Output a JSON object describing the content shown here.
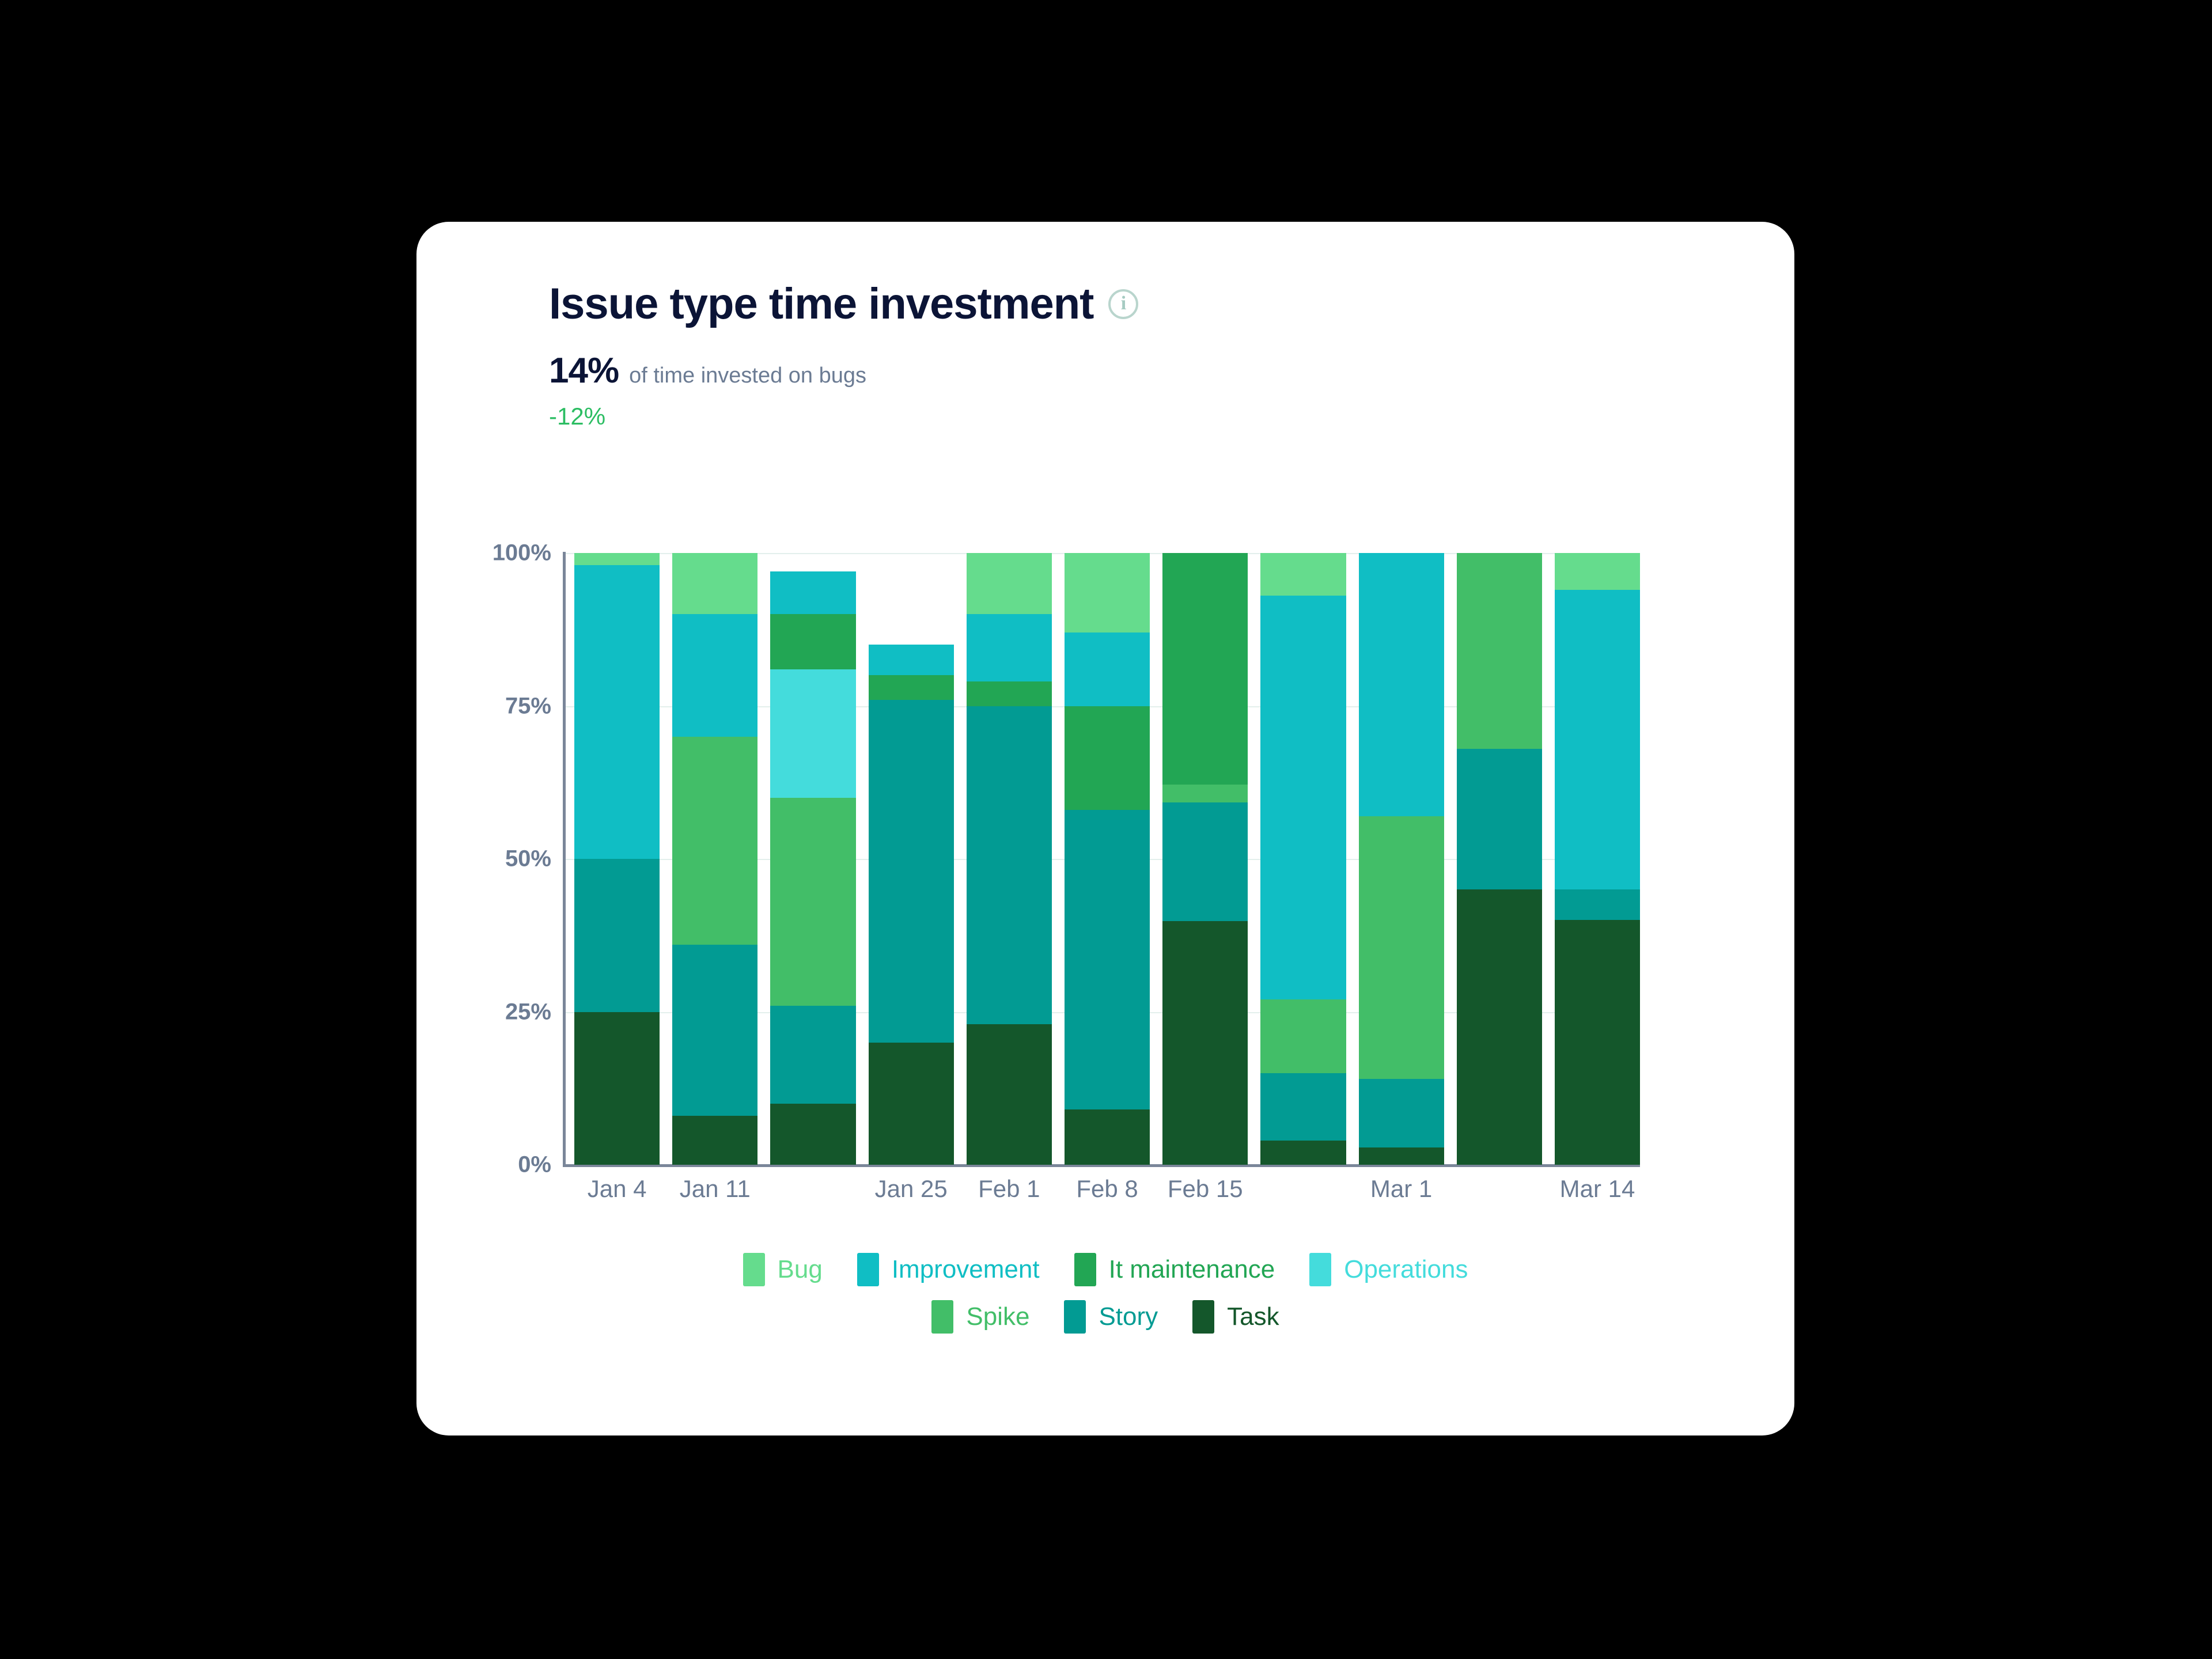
{
  "card": {
    "title": "Issue type time investment",
    "info_icon": "info-circle-icon",
    "kpi_value": "14%",
    "kpi_label": "of time invested on bugs",
    "kpi_delta": "-12%",
    "delta_color": "#2bbd62"
  },
  "chart_data": {
    "type": "bar",
    "stacked": true,
    "normalized_percent": true,
    "title": "Issue type time investment",
    "xlabel": "",
    "ylabel": "",
    "ylim": [
      0,
      100
    ],
    "yticks": [
      "0%",
      "25%",
      "50%",
      "75%",
      "100%"
    ],
    "ytick_values": [
      0,
      25,
      50,
      75,
      100
    ],
    "grid": true,
    "legend_position": "bottom",
    "categories": [
      "Jan 4",
      "Jan 11",
      "",
      "Jan 25",
      "Feb 1",
      "Feb 8",
      "Feb 15",
      "",
      "Mar 1",
      "",
      "Mar 14"
    ],
    "x_tick_labels_visible": [
      "Jan 4",
      "Jan 11",
      "Jan 25",
      "Feb 1",
      "Feb 8",
      "Feb 15",
      "Mar 1",
      "Mar 14"
    ],
    "series": [
      {
        "name": "Bug",
        "color": "#65DC8D",
        "values": [
          2,
          10,
          0,
          0,
          10,
          13,
          0,
          7,
          0,
          0,
          6
        ]
      },
      {
        "name": "Improvement",
        "color": "#10BEC4",
        "values": [
          48,
          20,
          7,
          5,
          11,
          12,
          0,
          66,
          46,
          0,
          49
        ]
      },
      {
        "name": "It maintenance",
        "color": "#22A654",
        "values": [
          0,
          0,
          9,
          4,
          4,
          17,
          39,
          0,
          0,
          0,
          0
        ]
      },
      {
        "name": "Operations",
        "color": "#44DCDC",
        "values": [
          0,
          0,
          21,
          0,
          0,
          0,
          0,
          0,
          0,
          0,
          0
        ]
      },
      {
        "name": "Spike",
        "color": "#42BE68",
        "values": [
          0,
          34,
          34,
          0,
          0,
          0,
          3,
          12,
          46,
          32,
          0
        ]
      },
      {
        "name": "Story",
        "color": "#029B93",
        "values": [
          25,
          28,
          16,
          56,
          52,
          49,
          20,
          11,
          12,
          23,
          5
        ]
      },
      {
        "name": "Task",
        "color": "#14572B",
        "values": [
          25,
          8,
          10,
          20,
          23,
          9,
          41,
          4,
          3,
          45,
          40
        ]
      }
    ],
    "stack_order_bottom_to_top": [
      "Task",
      "Story",
      "Spike",
      "Operations",
      "It maintenance",
      "Improvement",
      "Bug"
    ]
  },
  "legend": {
    "rows": [
      [
        {
          "label": "Bug",
          "color": "#65DC8D"
        },
        {
          "label": "Improvement",
          "color": "#10BEC4"
        },
        {
          "label": "It maintenance",
          "color": "#22A654"
        },
        {
          "label": "Operations",
          "color": "#44DCDC"
        }
      ],
      [
        {
          "label": "Spike",
          "color": "#42BE68"
        },
        {
          "label": "Story",
          "color": "#029B93"
        },
        {
          "label": "Task",
          "color": "#14572B"
        }
      ]
    ]
  }
}
